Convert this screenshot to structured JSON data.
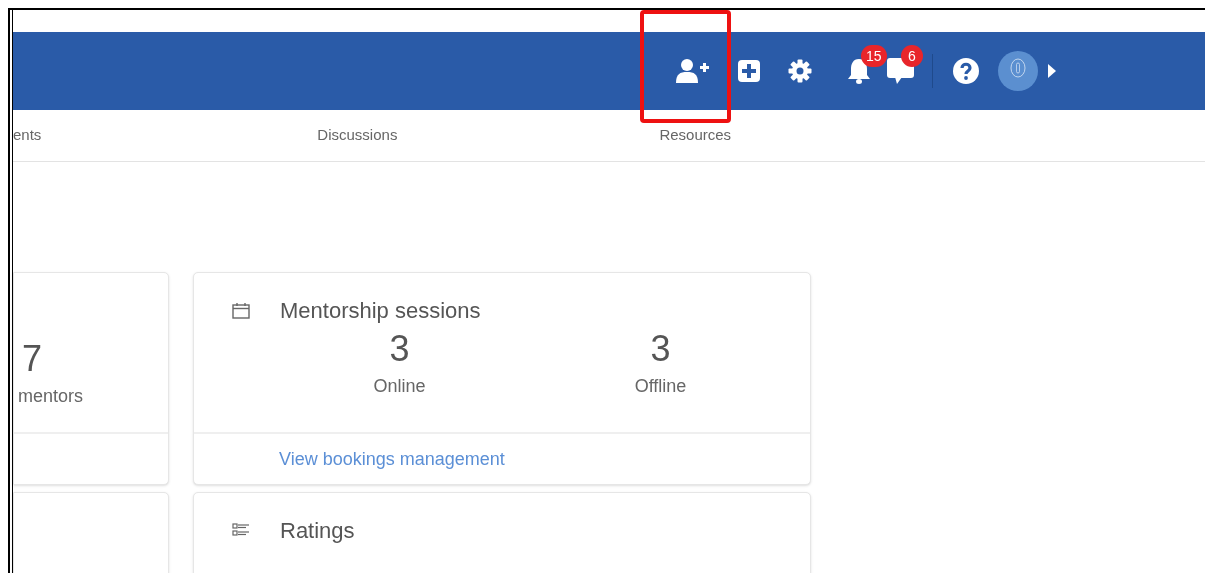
{
  "header": {
    "actions": [
      {
        "kind": "add-user",
        "highlighted": true
      },
      {
        "kind": "add",
        "highlighted": false
      },
      {
        "kind": "settings",
        "highlighted": false
      },
      {
        "kind": "notifications",
        "badge": "15",
        "highlighted": false
      },
      {
        "kind": "messages",
        "badge": "6",
        "highlighted": false
      },
      {
        "kind": "divider",
        "highlighted": false
      },
      {
        "kind": "help",
        "highlighted": false
      },
      {
        "kind": "avatar",
        "highlighted": false
      },
      {
        "kind": "caret",
        "highlighted": false
      }
    ]
  },
  "nav": [
    {
      "label": "ents"
    },
    {
      "label": "Discussions"
    },
    {
      "label": "Resources"
    }
  ],
  "cards": [
    {
      "kind": "sessions-count",
      "stats": [
        {
          "value": "7",
          "label": "mentors"
        }
      ]
    },
    {
      "kind": "sessions",
      "title": "Mentorship sessions",
      "stats": [
        {
          "value": "3",
          "label": "Online"
        },
        {
          "value": "3",
          "label": "Offline"
        }
      ],
      "link": "View bookings management"
    },
    {
      "kind": "blank"
    },
    {
      "kind": "ratings",
      "title": "Ratings"
    }
  ]
}
